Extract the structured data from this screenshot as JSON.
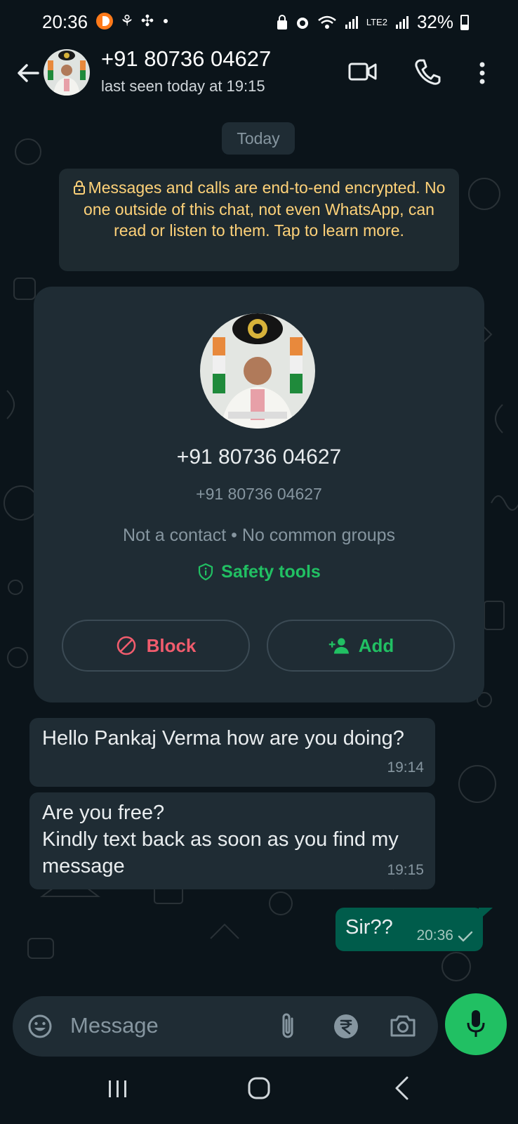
{
  "status_bar": {
    "time": "20:36",
    "battery": "32%",
    "network_label": "LTE2"
  },
  "header": {
    "contact_name": "+91 80736 04627",
    "last_seen": "last seen today at 19:15",
    "back_icon": "arrow-left-icon",
    "video_icon": "video-call-icon",
    "phone_icon": "voice-call-icon",
    "more_icon": "more-vertical-icon"
  },
  "chat": {
    "date_chip": "Today",
    "encryption_notice": "Messages and calls are end-to-end encrypted. No one outside of this chat, not even WhatsApp, can read or listen to them. Tap to learn more.",
    "profile_card": {
      "name": "+91 80736 04627",
      "number": "+91 80736 04627",
      "meta": "Not a contact • No common groups",
      "safety_label": "Safety tools",
      "block_label": "Block",
      "add_label": "Add"
    },
    "messages": [
      {
        "direction": "in",
        "text": "Hello Pankaj Verma how are you doing?",
        "time": "19:14"
      },
      {
        "direction": "in",
        "text": "Are you free?\nKindly text back as soon as you find my message",
        "time": "19:15"
      },
      {
        "direction": "out",
        "text": "Sir??",
        "time": "20:36",
        "status": "sent"
      }
    ]
  },
  "composer": {
    "placeholder": "Message",
    "emoji_icon": "emoji-icon",
    "attach_icon": "paperclip-icon",
    "payment_icon": "rupee-icon",
    "camera_icon": "camera-icon",
    "mic_icon": "microphone-icon"
  },
  "colors": {
    "background": "#0b141a",
    "bubble_in": "#1f2c34",
    "bubble_out": "#005c4b",
    "accent_green": "#21c063",
    "danger_red": "#f15c6d",
    "notice_yellow": "#ffd279"
  }
}
